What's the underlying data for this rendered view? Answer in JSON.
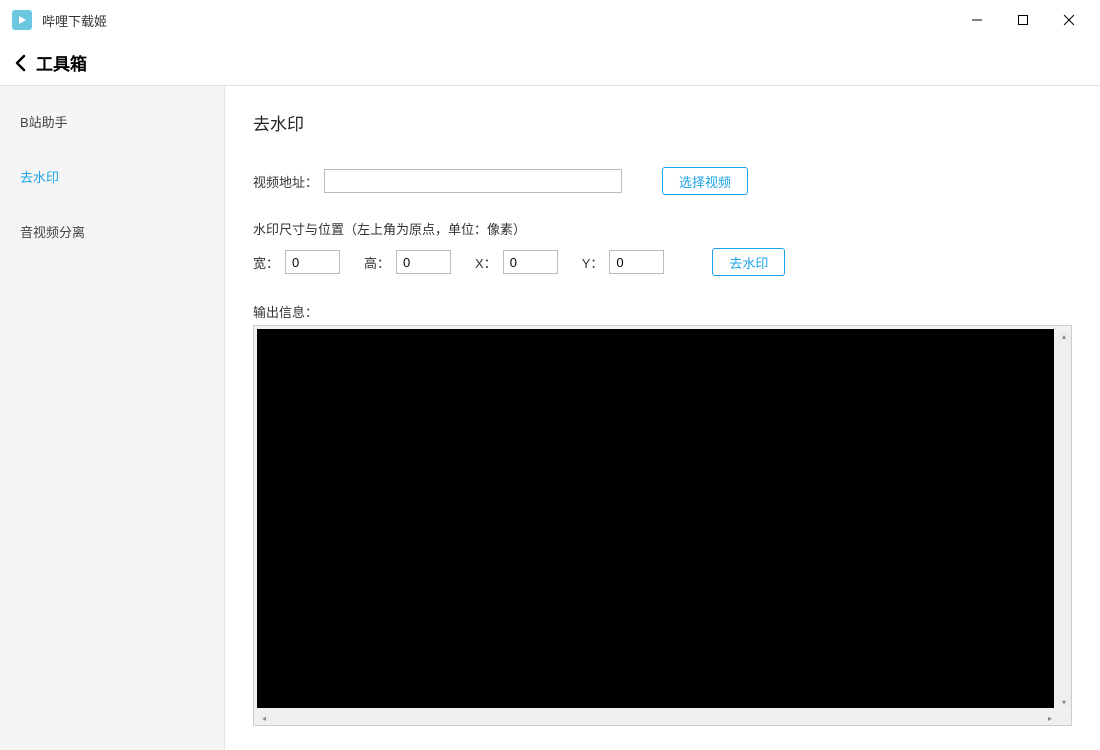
{
  "app": {
    "title": "哔哩下载姬"
  },
  "nav": {
    "title": "工具箱"
  },
  "sidebar": {
    "items": [
      {
        "label": "B站助手",
        "active": false
      },
      {
        "label": "去水印",
        "active": true
      },
      {
        "label": "音视频分离",
        "active": false
      }
    ]
  },
  "main": {
    "page_title": "去水印",
    "video_path_label": "视频地址：",
    "video_path_value": "",
    "select_video_label": "选择视频",
    "watermark_section_label": "水印尺寸与位置（左上角为原点，单位：像素）",
    "dims": {
      "width_label": "宽：",
      "width_value": "0",
      "height_label": "高：",
      "height_value": "0",
      "x_label": "X：",
      "x_value": "0",
      "y_label": "Y：",
      "y_value": "0"
    },
    "remove_watermark_label": "去水印",
    "output_label": "输出信息：",
    "output_content": ""
  },
  "colors": {
    "accent": "#1aa3e8",
    "sidebar_bg": "#f5f5f5"
  }
}
